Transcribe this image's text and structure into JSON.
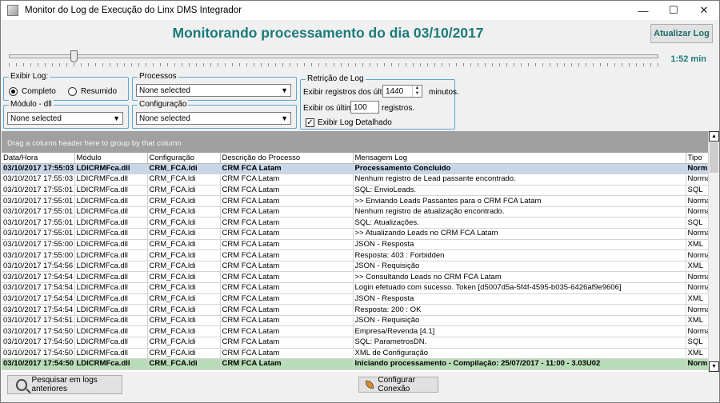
{
  "window": {
    "title": "Monitor do Log de Execução do Linx DMS Integrador",
    "minimize_icon": "minimize-icon",
    "maximize_icon": "maximize-icon",
    "close_icon": "close-icon"
  },
  "header": {
    "title": "Monitorando processamento do dia 03/10/2017",
    "refresh_label": "Atualizar Log"
  },
  "slider": {
    "value_label": "1:52 min",
    "level": 0.1
  },
  "exibir_log": {
    "legend": "Exibir Log:",
    "options": [
      {
        "label": "Completo",
        "selected": true
      },
      {
        "label": "Resumido",
        "selected": false
      }
    ]
  },
  "modulo": {
    "legend": "Módulo - dll",
    "value": "None selected"
  },
  "processos": {
    "legend": "Processos",
    "value": "None selected"
  },
  "configuracao": {
    "legend": "Configuração",
    "value": "None selected"
  },
  "retricao": {
    "legend": "Retrição de Log",
    "registros_label": "Exibir registros dos últimos",
    "registros_value": "1440",
    "minutos_label": "minutos.",
    "ultimos_label": "Exibir os últimos",
    "ultimos_value": "100",
    "registros_suffix": "registros.",
    "detalhado_label": "Exibir Log Detalhado",
    "detalhado_checked": true
  },
  "grid": {
    "group_hint": "Drag a column header here to group by that column",
    "columns": [
      "Data/Hora",
      "Módulo",
      "Configuração",
      "Descrição do Processo",
      "Mensagem Log",
      "Tipo"
    ],
    "rows": [
      {
        "style": "hl-blue bold",
        "cells": [
          "03/10/2017 17:55:03",
          "LDICRMFca.dll",
          "CRM_FCA.ldi",
          "CRM FCA Latam",
          "Processamento Concluido",
          "Norm"
        ]
      },
      {
        "style": "",
        "cells": [
          "03/10/2017 17:55:03",
          "LDICRMFca.dll",
          "CRM_FCA.ldi",
          "CRM FCA Latam",
          "Nenhum registro de Lead passante encontrado.",
          "Norma"
        ]
      },
      {
        "style": "",
        "cells": [
          "03/10/2017 17:55:01",
          "LDICRMFca.dll",
          "CRM_FCA.ldi",
          "CRM FCA Latam",
          "SQL: EnvioLeads.",
          "SQL"
        ]
      },
      {
        "style": "",
        "cells": [
          "03/10/2017 17:55:01",
          "LDICRMFca.dll",
          "CRM_FCA.ldi",
          "CRM FCA Latam",
          ">> Enviando Leads Passantes para o CRM FCA Latam",
          "Norma"
        ]
      },
      {
        "style": "",
        "cells": [
          "03/10/2017 17:55:01",
          "LDICRMFca.dll",
          "CRM_FCA.ldi",
          "CRM FCA Latam",
          "Nenhum registro de atualização encontrado.",
          "Norma"
        ]
      },
      {
        "style": "",
        "cells": [
          "03/10/2017 17:55:01",
          "LDICRMFca.dll",
          "CRM_FCA.ldi",
          "CRM FCA Latam",
          "SQL: Atualizações.",
          "SQL"
        ]
      },
      {
        "style": "",
        "cells": [
          "03/10/2017 17:55:01",
          "LDICRMFca.dll",
          "CRM_FCA.ldi",
          "CRM FCA Latam",
          ">> Atualizando Leads no CRM FCA Latam",
          "Norma"
        ]
      },
      {
        "style": "",
        "cells": [
          "03/10/2017 17:55:00",
          "LDICRMFca.dll",
          "CRM_FCA.ldi",
          "CRM FCA Latam",
          "JSON - Resposta",
          "XML"
        ]
      },
      {
        "style": "",
        "cells": [
          "03/10/2017 17:55:00",
          "LDICRMFca.dll",
          "CRM_FCA.ldi",
          "CRM FCA Latam",
          "Resposta: 403 : Forbidden",
          "Norma"
        ]
      },
      {
        "style": "",
        "cells": [
          "03/10/2017 17:54:56",
          "LDICRMFca.dll",
          "CRM_FCA.ldi",
          "CRM FCA Latam",
          "JSON - Requisição",
          "XML"
        ]
      },
      {
        "style": "",
        "cells": [
          "03/10/2017 17:54:54",
          "LDICRMFca.dll",
          "CRM_FCA.ldi",
          "CRM FCA Latam",
          ">> Consultando Leads no CRM FCA Latam",
          "Norma"
        ]
      },
      {
        "style": "",
        "cells": [
          "03/10/2017 17:54:54",
          "LDICRMFca.dll",
          "CRM_FCA.ldi",
          "CRM FCA Latam",
          "Login efetuado com sucesso. Token [d5007d5a-5f4f-4595-b035-6426af9e9606]",
          "Norma"
        ]
      },
      {
        "style": "",
        "cells": [
          "03/10/2017 17:54:54",
          "LDICRMFca.dll",
          "CRM_FCA.ldi",
          "CRM FCA Latam",
          "JSON - Resposta",
          "XML"
        ]
      },
      {
        "style": "",
        "cells": [
          "03/10/2017 17:54:54",
          "LDICRMFca.dll",
          "CRM_FCA.ldi",
          "CRM FCA Latam",
          "Resposta: 200 : OK",
          "Norma"
        ]
      },
      {
        "style": "",
        "cells": [
          "03/10/2017 17:54:51",
          "LDICRMFca.dll",
          "CRM_FCA.ldi",
          "CRM FCA Latam",
          "JSON - Requisição",
          "XML"
        ]
      },
      {
        "style": "",
        "cells": [
          "03/10/2017 17:54:50",
          "LDICRMFca.dll",
          "CRM_FCA.ldi",
          "CRM FCA Latam",
          "Empresa/Revenda [4.1]",
          "Norma"
        ]
      },
      {
        "style": "",
        "cells": [
          "03/10/2017 17:54:50",
          "LDICRMFca.dll",
          "CRM_FCA.ldi",
          "CRM FCA Latam",
          "SQL: ParametrosDN.",
          "SQL"
        ]
      },
      {
        "style": "",
        "cells": [
          "03/10/2017 17:54:50",
          "LDICRMFca.dll",
          "CRM_FCA.ldi",
          "CRM FCA Latam",
          "XML de Configuração",
          "XML"
        ]
      },
      {
        "style": "hl-green bold",
        "cells": [
          "03/10/2017 17:54:50",
          "LDICRMFca.dll",
          "CRM_FCA.ldi",
          "CRM FCA Latam",
          "Iniciando processamento - Compilação: 25/07/2017 - 11:00 - 3.03U02",
          "Norm"
        ]
      }
    ]
  },
  "footer": {
    "search_label": "Pesquisar em logs anteriores",
    "config_label": "Configurar Conexão"
  }
}
